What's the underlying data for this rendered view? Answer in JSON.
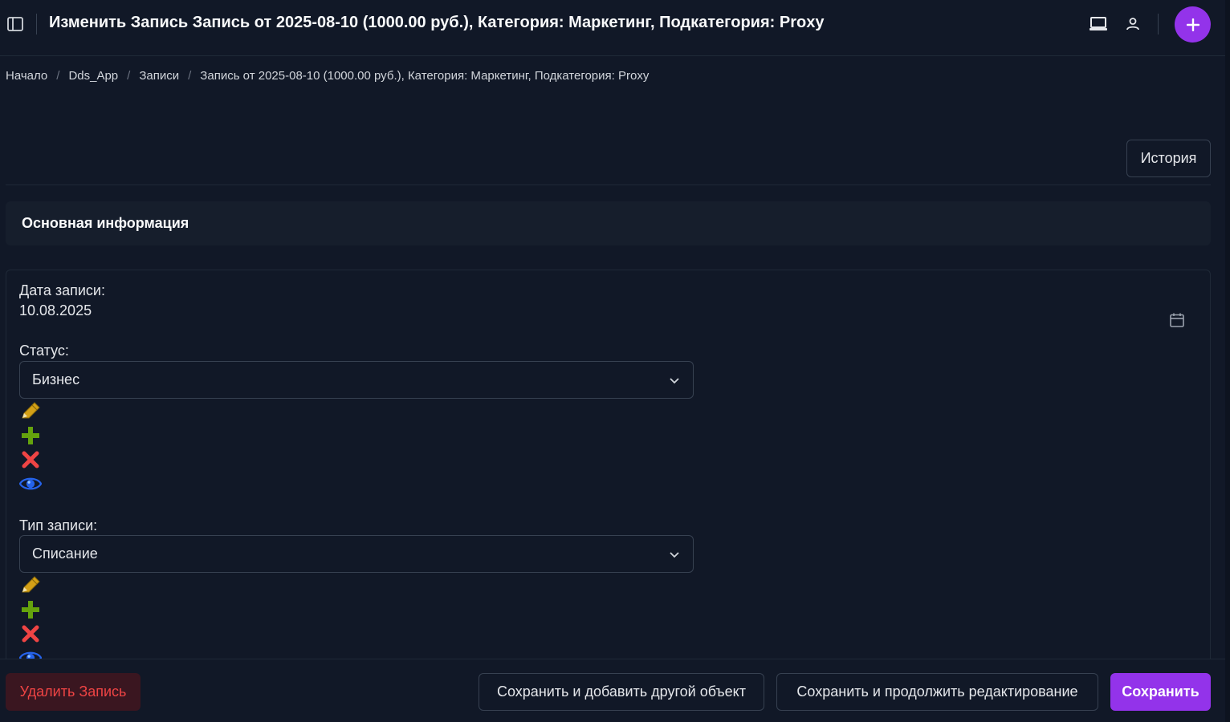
{
  "header": {
    "title": "Изменить Запись Запись от 2025-08-10 (1000.00 руб.), Категория: Маркетинг, Подкатегория: Proxy"
  },
  "breadcrumb": [
    "Начало",
    "Dds_App",
    "Записи",
    "Запись от 2025-08-10 (1000.00 руб.), Категория: Маркетинг, Подкатегория: Proxy"
  ],
  "toolbar": {
    "history_label": "История"
  },
  "section": {
    "title": "Основная информация"
  },
  "form": {
    "date_label": "Дата записи:",
    "date_value": "10.08.2025",
    "status_label": "Статус:",
    "status_value": "Бизнес",
    "type_label": "Тип записи:",
    "type_value": "Списание"
  },
  "footer": {
    "delete_label": "Удалить Запись",
    "save_add_label": "Сохранить и добавить другой объект",
    "save_continue_label": "Сохранить и продолжить редактирование",
    "save_label": "Сохранить"
  },
  "colors": {
    "background": "#111827",
    "accent": "#9333ea",
    "danger": "#ef4444",
    "edit_icon": "#d4a017",
    "add_icon": "#65a30d",
    "delete_icon": "#ef4444",
    "view_icon": "#2563eb"
  },
  "icons": [
    "sidebar-toggle-icon",
    "laptop-icon",
    "user-icon",
    "plus-icon",
    "calendar-icon",
    "chevron-down-icon",
    "pencil-icon",
    "add-related-icon",
    "delete-related-icon",
    "view-related-icon"
  ]
}
